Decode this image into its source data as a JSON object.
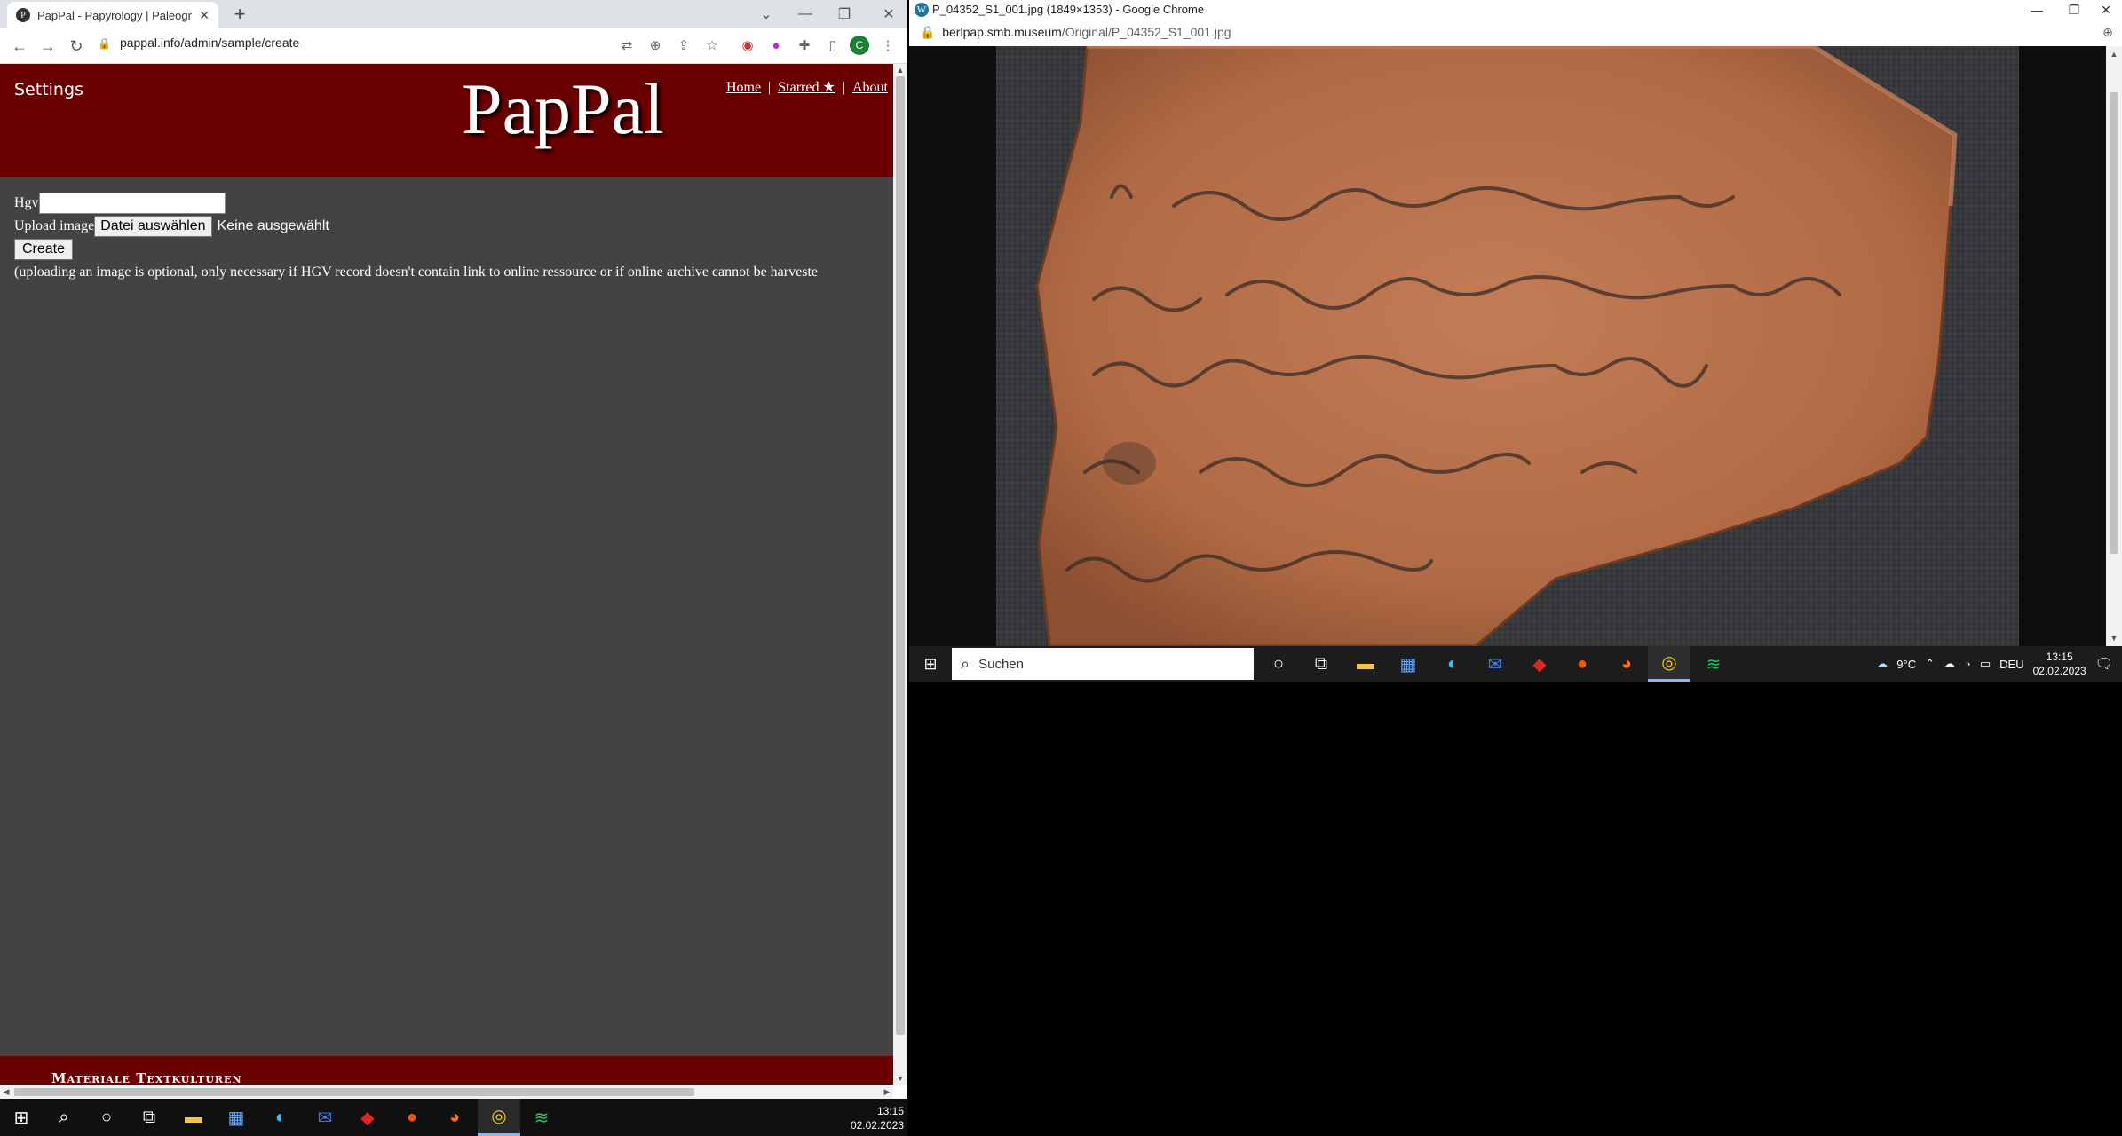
{
  "left_browser": {
    "tab_title": "PapPal - Papyrology | Paleography",
    "url": "pappal.info/admin/sample/create",
    "profile_initial": "C"
  },
  "site": {
    "settings_label": "Settings",
    "logo": "PapPal",
    "nav": [
      "Home",
      "Starred ★",
      "About"
    ],
    "form": {
      "hgv_label": "Hgv",
      "hgv_value": "",
      "upload_label": "Upload image",
      "file_button": "Datei auswählen",
      "file_none": "Keine ausgewählt",
      "create_button": "Create",
      "note": "(uploading an image is optional, only necessary if HGV record doesn't contain link to online ressource or if online archive cannot be harveste"
    },
    "footer_text": "Materiale Textkulturen"
  },
  "left_taskbar": {
    "time": "13:15",
    "date": "02.02.2023"
  },
  "right_browser": {
    "window_title": "P_04352_S1_001.jpg (1849×1353) - Google Chrome",
    "url_host": "berlpap.smb.museum",
    "url_path": "/Original/P_04352_S1_001.jpg"
  },
  "right_taskbar": {
    "search_placeholder": "Suchen",
    "weather": "9°C",
    "language": "DEU",
    "time": "13:15",
    "date": "02.02.2023"
  },
  "colors": {
    "site_maroon": "#6b0000",
    "page_gray": "#434343",
    "ostracon": "#b8734e"
  }
}
